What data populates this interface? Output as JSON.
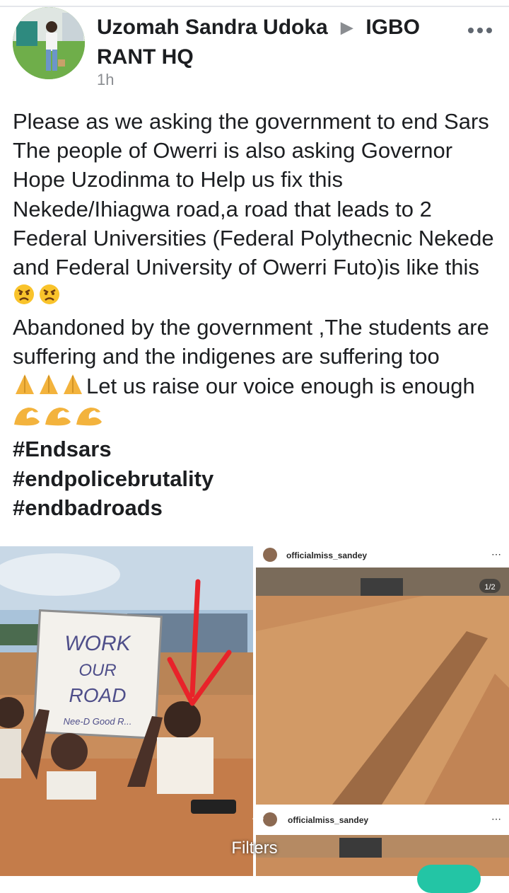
{
  "post": {
    "author": "Uzomah Sandra Udoka",
    "group": "IGBO RANT HQ",
    "time": "1h",
    "lines": [
      "Please as we asking the government to end Sars",
      "The people of Owerri is also asking Governor Hope Uzodinma to Help us fix this Nekede/Ihiagwa road,a road that leads to 2 Federal Universities (Federal Polythecnic Nekede and Federal University of Owerri Futo)is like this",
      "Abandoned by the government ,The students are suffering and the indigenes are suffering too",
      "Let us raise our voice enough is enough"
    ],
    "hashtags": [
      "#Endsars",
      "#endpolicebrutality",
      "#endbadroads"
    ]
  },
  "photos": {
    "sign": [
      "WORK",
      "OUR",
      "ROAD",
      "Nee-D Good R..."
    ],
    "ig_user": "officialmiss_sandey",
    "ig_user_2": "officialmiss_sandey",
    "counter": "1/2"
  },
  "filters_label": "Filters",
  "colors": {
    "fab": "#23c5a5",
    "muted": "#8a8d91",
    "arrow": "#e8232a",
    "mud": "#c98d5c"
  }
}
